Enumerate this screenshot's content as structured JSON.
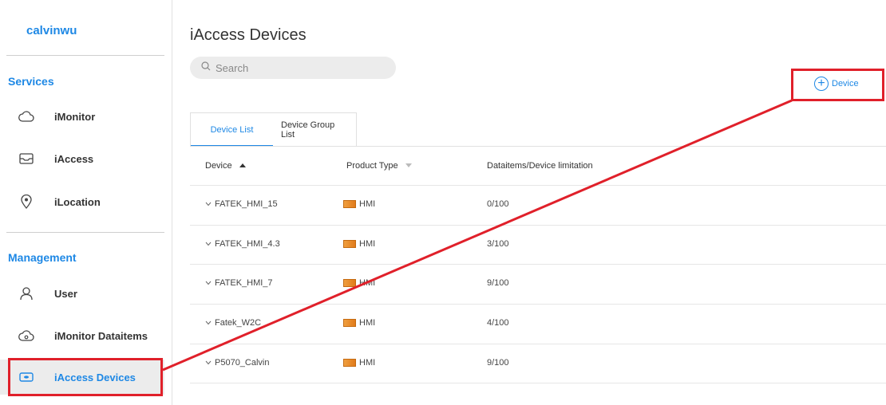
{
  "sidebar": {
    "brand": "calvinwu",
    "services_title": "Services",
    "services": [
      {
        "label": "iMonitor",
        "icon": "cloud-icon"
      },
      {
        "label": "iAccess",
        "icon": "inbox-icon"
      },
      {
        "label": "iLocation",
        "icon": "location-pin-icon"
      }
    ],
    "management_title": "Management",
    "management": [
      {
        "label": "User",
        "icon": "user-icon"
      },
      {
        "label": "iMonitor Dataitems",
        "icon": "cloud-settings-icon"
      },
      {
        "label": "iAccess Devices",
        "icon": "device-icon"
      }
    ]
  },
  "main": {
    "title": "iAccess Devices",
    "search_placeholder": "Search",
    "add_device_label": "Device",
    "tabs": [
      {
        "label": "Device List",
        "active": true
      },
      {
        "label": "Device Group List",
        "active": false
      }
    ],
    "columns": [
      "Device",
      "Product Type",
      "Dataitems/Device limitation"
    ],
    "rows": [
      {
        "device": "FATEK_HMI_15",
        "type": "HMI",
        "limit": "0/100"
      },
      {
        "device": "FATEK_HMI_4.3",
        "type": "HMI",
        "limit": "3/100"
      },
      {
        "device": "FATEK_HMI_7",
        "type": "HMI",
        "limit": "9/100"
      },
      {
        "device": "Fatek_W2C",
        "type": "HMI",
        "limit": "4/100"
      },
      {
        "device": "P5070_Calvin",
        "type": "HMI",
        "limit": "9/100"
      }
    ]
  },
  "colors": {
    "accent": "#1e88e5",
    "annotation": "#e0202a"
  }
}
